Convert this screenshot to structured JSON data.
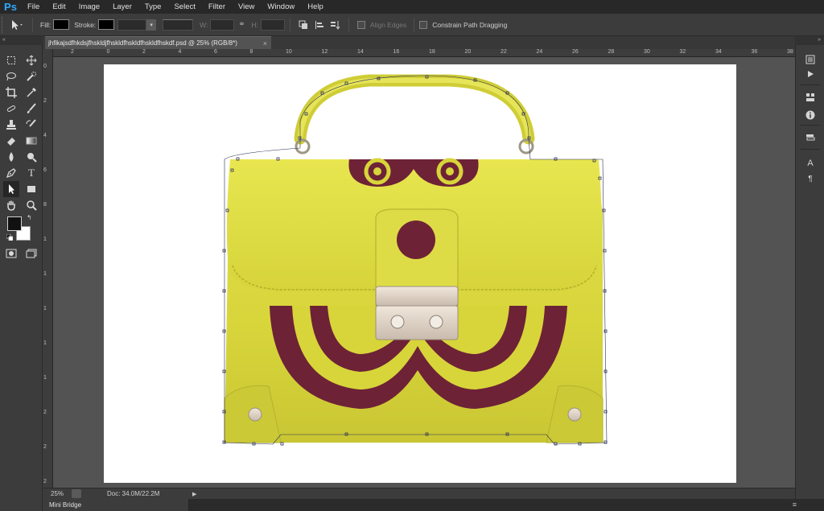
{
  "app": {
    "logo": "Ps"
  },
  "menu": [
    "File",
    "Edit",
    "Image",
    "Layer",
    "Type",
    "Select",
    "Filter",
    "View",
    "Window",
    "Help"
  ],
  "options": {
    "tool_icon": "path-selection-icon",
    "fill_label": "Fill:",
    "stroke_label": "Stroke:",
    "width_label": "W:",
    "height_label": "H:",
    "align_edges_label": "Align Edges",
    "constrain_label": "Constrain Path Dragging",
    "fill_color": "#000000",
    "stroke_color": "#000000"
  },
  "document": {
    "tab_title": "jhfikajsdfhkdsjfhskldjfhskldfhskldfhskldfhskdf.psd @ 25% (RGB/8*)",
    "tab_close": "×",
    "background": "#ffffff",
    "bag_color": "#d8d73a",
    "suede_color": "#6e2236"
  },
  "rulers": {
    "horizontal": [
      "2",
      "0",
      "2",
      "4",
      "6",
      "8",
      "10",
      "12",
      "14",
      "16",
      "18",
      "20",
      "22",
      "24",
      "26",
      "28",
      "30",
      "32",
      "34",
      "36",
      "38"
    ],
    "vertical": [
      "0",
      "2",
      "4",
      "6",
      "8",
      "1",
      "1",
      "1",
      "1",
      "1",
      "2",
      "2",
      "2"
    ]
  },
  "status": {
    "zoom": "25%",
    "doc": "Doc: 34.0M/22.2M",
    "arrow": "▶"
  },
  "minibridge": {
    "label": "Mini Bridge",
    "menu_icon": "≡"
  },
  "colors": {
    "foreground": "#111111",
    "background": "#ffffff",
    "accent": "#31a8ff"
  }
}
